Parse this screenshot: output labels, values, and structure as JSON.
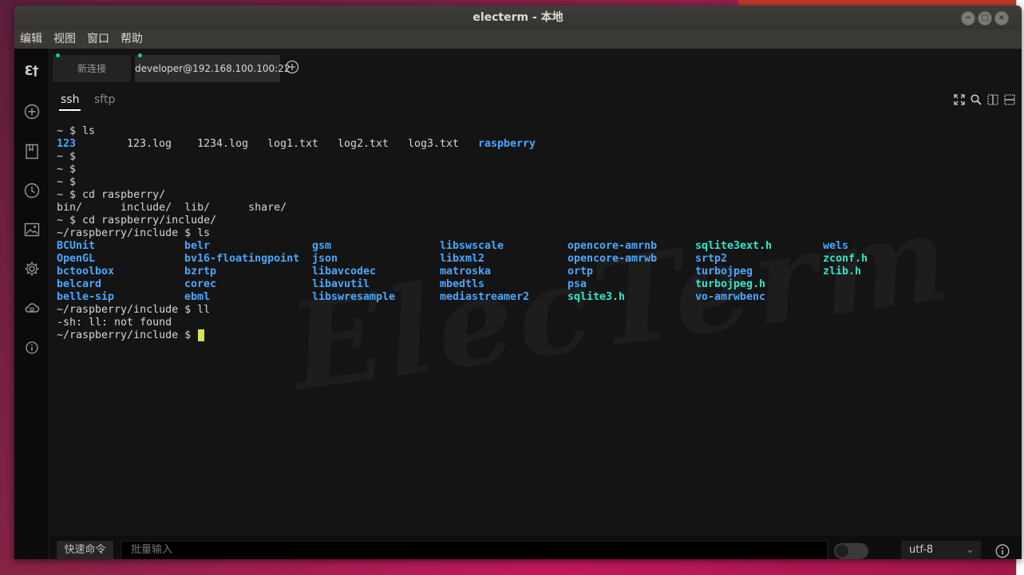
{
  "window": {
    "title": "electerm - 本地",
    "controls": [
      "−",
      "□",
      "×"
    ]
  },
  "menu": [
    "编辑",
    "视图",
    "窗口",
    "帮助"
  ],
  "sidebar": {
    "logo": "ℇ†",
    "icons": [
      "plus-circle-icon",
      "bookmark-icon",
      "history-icon",
      "picture-icon",
      "settings-icon",
      "cloud-sync-icon",
      "info-icon"
    ]
  },
  "tabs": [
    {
      "label": "新连接",
      "active": false
    },
    {
      "label": "developer@192.168.100.100:22",
      "active": true
    }
  ],
  "subtabs": [
    "ssh",
    "sftp"
  ],
  "terminal": {
    "watermark": "ElecTerm",
    "lines": [
      "~ $ ls",
      "",
      "~ $",
      "~ $",
      "~ $",
      "~ $ cd raspberry/",
      "bin/      include/  lib/      share/",
      "~ $ cd raspberry/include/",
      "~/raspberry/include $ ls",
      "",
      "",
      "",
      "",
      "",
      "~/raspberry/include $ ll",
      "-sh: ll: not found",
      "~/raspberry/include $ "
    ],
    "ls_home": [
      {
        "text": "123",
        "kind": "dir"
      },
      {
        "text": "123.log",
        "kind": "file"
      },
      {
        "text": "1234.log",
        "kind": "file"
      },
      {
        "text": "log1.txt",
        "kind": "file"
      },
      {
        "text": "log2.txt",
        "kind": "file"
      },
      {
        "text": "log3.txt",
        "kind": "file"
      },
      {
        "text": "raspberry",
        "kind": "dir"
      }
    ],
    "ls_include": [
      [
        "BCUnit",
        "OpenGL",
        "bctoolbox",
        "belcard",
        "belle-sip"
      ],
      [
        "belr",
        "bv16-floatingpoint",
        "bzrtp",
        "corec",
        "ebml"
      ],
      [
        "gsm",
        "json",
        "libavcodec",
        "libavutil",
        "libswresample"
      ],
      [
        "libswscale",
        "libxml2",
        "matroska",
        "mbedtls",
        "mediastreamer2"
      ],
      [
        "opencore-amrnb",
        "opencore-amrwb",
        "ortp",
        "psa",
        "sqlite3.h"
      ],
      [
        "sqlite3ext.h",
        "srtp2",
        "turbojpeg",
        "turbojpeg.h",
        "vo-amrwbenc"
      ],
      [
        "wels",
        "zconf.h",
        "zlib.h"
      ]
    ]
  },
  "bottom": {
    "quick_command": "快速命令",
    "batch_input_placeholder": "批量输入",
    "encoding": "utf-8"
  },
  "colors": {
    "dir": "#4aa8ff",
    "header_file": "#2fe8c7",
    "cursor": "#d8e05a"
  }
}
